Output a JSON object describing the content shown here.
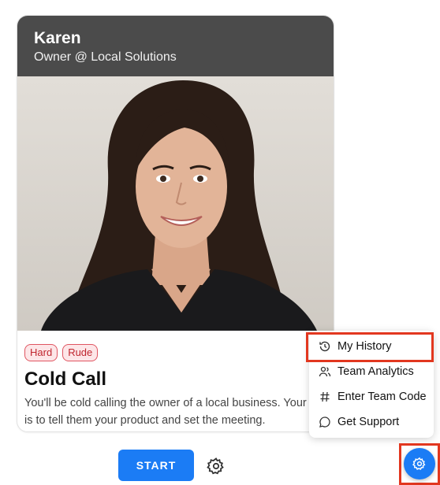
{
  "card": {
    "name": "Karen",
    "role": "Owner @ Local Solutions",
    "tags": [
      "Hard",
      "Rude"
    ],
    "title": "Cold Call",
    "description_line1": "You'll be cold calling the owner of a local business. Your",
    "description_line2": "is to tell them your product and set the meeting."
  },
  "actions": {
    "start_label": "START"
  },
  "menu": {
    "items": [
      {
        "label": "My History",
        "icon": "history-icon",
        "highlighted": true
      },
      {
        "label": "Team Analytics",
        "icon": "users-icon"
      },
      {
        "label": "Enter Team Code",
        "icon": "hash-icon"
      },
      {
        "label": "Get Support",
        "icon": "chat-bubble-icon"
      }
    ]
  },
  "colors": {
    "primary": "#1b7cf5",
    "header_bg": "#4b4b4b",
    "tag_red": "#c0262f",
    "highlight_red": "#e2371f"
  }
}
